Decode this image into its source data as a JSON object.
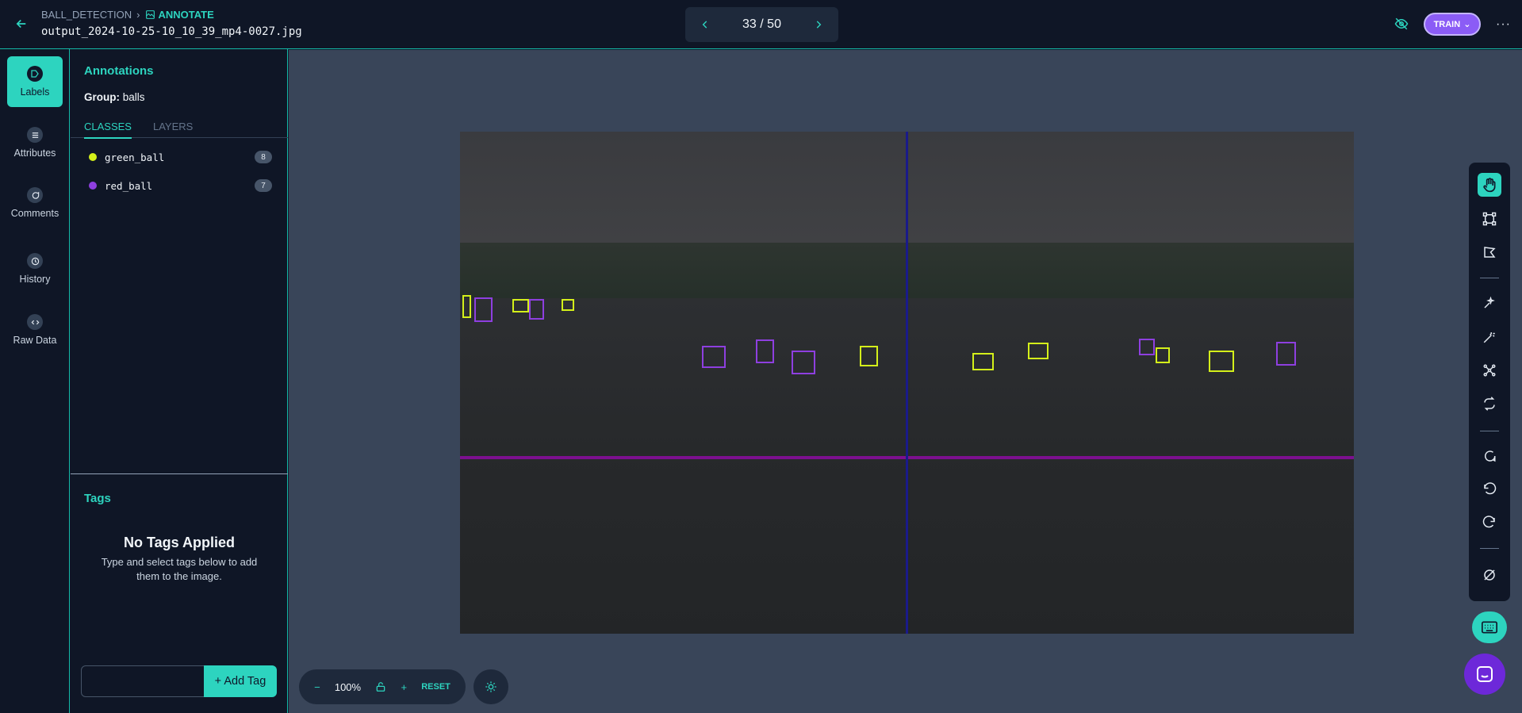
{
  "header": {
    "breadcrumb_project": "BALL_DETECTION",
    "breadcrumb_current": "ANNOTATE",
    "filename": "output_2024-10-25-10_10_39_mp4-0027.jpg",
    "page_indicator": "33 / 50",
    "train_label": "TRAIN",
    "more_label": "···"
  },
  "nav": {
    "items": [
      {
        "label": "Labels",
        "icon": "label-icon"
      },
      {
        "label": "Attributes",
        "icon": "list-icon"
      },
      {
        "label": "Comments",
        "icon": "comment-icon"
      },
      {
        "label": "History",
        "icon": "history-icon"
      },
      {
        "label": "Raw Data",
        "icon": "code-icon"
      }
    ]
  },
  "annotations": {
    "title": "Annotations",
    "group_label": "Group:",
    "group_value": "balls",
    "tabs": [
      "CLASSES",
      "LAYERS"
    ],
    "classes": [
      {
        "name": "green_ball",
        "count": "8",
        "color": "#d4f01a"
      },
      {
        "name": "red_ball",
        "count": "7",
        "color": "#8e3fe0"
      }
    ]
  },
  "tags": {
    "title": "Tags",
    "empty_title": "No Tags Applied",
    "empty_sub": "Type and select tags below to add them to the image.",
    "input_value": "",
    "add_label": "+ Add Tag"
  },
  "zoom": {
    "minus": "−",
    "level": "100%",
    "plus": "+",
    "reset": "RESET"
  },
  "colors": {
    "accent": "#2dd4bf",
    "train_purple": "#8b5cf6",
    "green_ball_box": "#d4f01a",
    "red_ball_box": "#8e3fe0"
  }
}
